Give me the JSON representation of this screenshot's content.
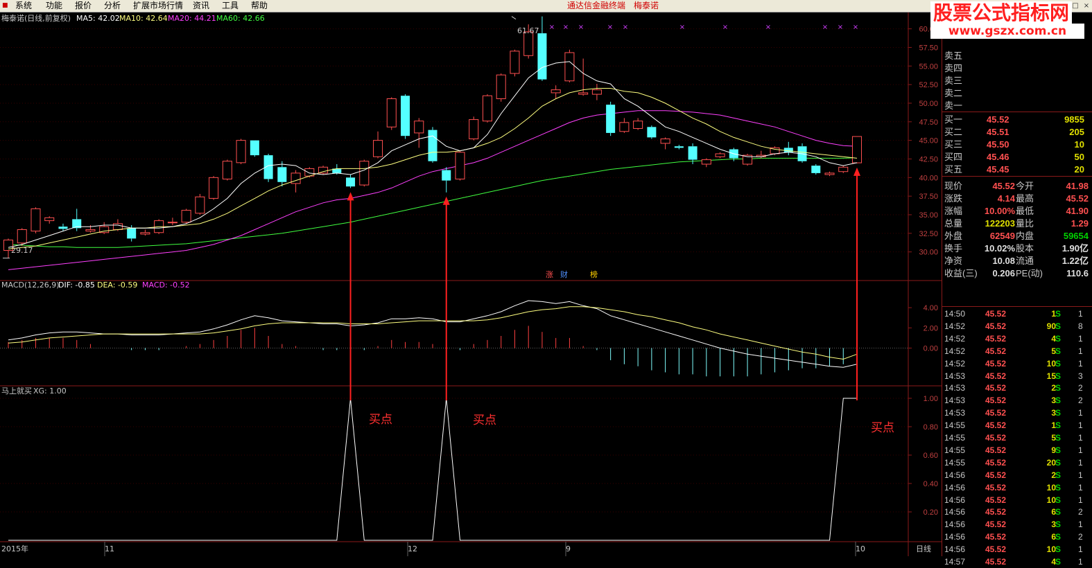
{
  "menu": {
    "items": [
      "系统",
      "功能",
      "报价",
      "分析",
      "扩展市场行情",
      "资讯",
      "工具",
      "帮助"
    ],
    "app_title": "通达信金融终端",
    "stock_title": "梅泰诺"
  },
  "watermark": {
    "line1": "股票公式指标网",
    "line2": "www.gszx.com.cn"
  },
  "main_header": {
    "name": "梅泰诺(日线,前复权)",
    "ma5": "MA5: 42.02",
    "ma10": "MA10: 42.64",
    "ma20": "MA20: 44.21",
    "ma60": "MA60: 42.66",
    "high_label": "61.67",
    "low_label": "29.17"
  },
  "macd_header": {
    "name": "MACD(12,26,9)",
    "dif": "DIF: -0.85",
    "dea": "DEA: -0.59",
    "macd": "MACD: -0.52"
  },
  "xg_header": {
    "name": "马上就买",
    "xg": "XG: 1.00"
  },
  "badges": [
    "涨",
    "财",
    "榜"
  ],
  "buy_labels": [
    "买点",
    "买点",
    "买点"
  ],
  "axis": {
    "price_ticks": [
      "60.00",
      "57.50",
      "55.00",
      "52.50",
      "50.00",
      "47.50",
      "45.00",
      "42.50",
      "40.00",
      "37.50",
      "35.00",
      "32.50",
      "30.00"
    ],
    "macd_ticks": [
      "4.00",
      "2.00",
      "0.00"
    ],
    "xg_ticks": [
      "1.00",
      "0.80",
      "0.60",
      "0.40",
      "0.20"
    ],
    "x_labels": [
      "2015年",
      "11",
      "12",
      "9",
      "10"
    ],
    "period": "日线"
  },
  "colors": {
    "up": "#ff5050",
    "down": "#54ffff",
    "ma5": "#ffffff",
    "ma10": "#ffff80",
    "ma20": "#ff40ff",
    "ma60": "#40ff40",
    "border": "#8b1a1a"
  },
  "order_book": {
    "sell": [
      {
        "label": "卖五",
        "price": "",
        "vol": ""
      },
      {
        "label": "卖四",
        "price": "",
        "vol": ""
      },
      {
        "label": "卖三",
        "price": "",
        "vol": ""
      },
      {
        "label": "卖二",
        "price": "",
        "vol": ""
      },
      {
        "label": "卖一",
        "price": "",
        "vol": ""
      }
    ],
    "buy": [
      {
        "label": "买一",
        "price": "45.52",
        "vol": "9855"
      },
      {
        "label": "买二",
        "price": "45.51",
        "vol": "205"
      },
      {
        "label": "买三",
        "price": "45.50",
        "vol": "10"
      },
      {
        "label": "买四",
        "price": "45.46",
        "vol": "50"
      },
      {
        "label": "买五",
        "price": "45.45",
        "vol": "20"
      }
    ]
  },
  "quote": [
    [
      {
        "label": "现价",
        "value": "45.52",
        "color": "#ff5050"
      },
      {
        "label": "今开",
        "value": "41.98",
        "color": "#ff5050"
      }
    ],
    [
      {
        "label": "涨跌",
        "value": "4.14",
        "color": "#ff5050"
      },
      {
        "label": "最高",
        "value": "45.52",
        "color": "#ff5050"
      }
    ],
    [
      {
        "label": "涨幅",
        "value": "10.00%",
        "color": "#ff5050"
      },
      {
        "label": "最低",
        "value": "41.90",
        "color": "#ff5050"
      }
    ],
    [
      {
        "label": "总量",
        "value": "122203",
        "color": "#e0e000"
      },
      {
        "label": "量比",
        "value": "1.29",
        "color": "#ff5050"
      }
    ],
    [
      {
        "label": "外盘",
        "value": "62549",
        "color": "#ff5050"
      },
      {
        "label": "内盘",
        "value": "59654",
        "color": "#00d000"
      }
    ],
    [
      {
        "label": "换手",
        "value": "10.02%",
        "color": "#e0e0e0"
      },
      {
        "label": "股本",
        "value": "1.90亿",
        "color": "#e0e0e0"
      }
    ],
    [
      {
        "label": "净资",
        "value": "10.08",
        "color": "#e0e0e0"
      },
      {
        "label": "流通",
        "value": "1.22亿",
        "color": "#e0e0e0"
      }
    ],
    [
      {
        "label": "收益(三)",
        "value": "0.206",
        "color": "#e0e0e0"
      },
      {
        "label": "PE(动)",
        "value": "110.6",
        "color": "#e0e0e0"
      }
    ]
  ],
  "ticks": [
    {
      "time": "14:50",
      "price": "45.52",
      "vol": "1",
      "side": "S",
      "num": "1"
    },
    {
      "time": "14:52",
      "price": "45.52",
      "vol": "90",
      "side": "S",
      "num": "8"
    },
    {
      "time": "14:52",
      "price": "45.52",
      "vol": "4",
      "side": "S",
      "num": "1"
    },
    {
      "time": "14:52",
      "price": "45.52",
      "vol": "5",
      "side": "S",
      "num": "1"
    },
    {
      "time": "14:52",
      "price": "45.52",
      "vol": "10",
      "side": "S",
      "num": "1"
    },
    {
      "time": "14:53",
      "price": "45.52",
      "vol": "15",
      "side": "S",
      "num": "3"
    },
    {
      "time": "14:53",
      "price": "45.52",
      "vol": "2",
      "side": "S",
      "num": "2"
    },
    {
      "time": "14:53",
      "price": "45.52",
      "vol": "3",
      "side": "S",
      "num": "2"
    },
    {
      "time": "14:53",
      "price": "45.52",
      "vol": "3",
      "side": "S",
      "num": "1"
    },
    {
      "time": "14:55",
      "price": "45.52",
      "vol": "1",
      "side": "S",
      "num": "1"
    },
    {
      "time": "14:55",
      "price": "45.52",
      "vol": "5",
      "side": "S",
      "num": "1"
    },
    {
      "time": "14:55",
      "price": "45.52",
      "vol": "9",
      "side": "S",
      "num": "1"
    },
    {
      "time": "14:55",
      "price": "45.52",
      "vol": "20",
      "side": "S",
      "num": "1"
    },
    {
      "time": "14:56",
      "price": "45.52",
      "vol": "2",
      "side": "S",
      "num": "1"
    },
    {
      "time": "14:56",
      "price": "45.52",
      "vol": "10",
      "side": "S",
      "num": "1"
    },
    {
      "time": "14:56",
      "price": "45.52",
      "vol": "10",
      "side": "S",
      "num": "1"
    },
    {
      "time": "14:56",
      "price": "45.52",
      "vol": "6",
      "side": "S",
      "num": "2"
    },
    {
      "time": "14:56",
      "price": "45.52",
      "vol": "3",
      "side": "S",
      "num": "1"
    },
    {
      "time": "14:56",
      "price": "45.52",
      "vol": "6",
      "side": "S",
      "num": "2"
    },
    {
      "time": "14:56",
      "price": "45.52",
      "vol": "10",
      "side": "S",
      "num": "1"
    },
    {
      "time": "14:57",
      "price": "45.52",
      "vol": "4",
      "side": "S",
      "num": "1"
    }
  ],
  "chart_data": {
    "type": "candlestick",
    "title": "梅泰诺(日线,前复权)",
    "ylim": [
      28.2,
      62.2
    ],
    "candles": [
      {
        "o": 30.2,
        "h": 31.8,
        "l": 29.17,
        "c": 31.6
      },
      {
        "o": 31.2,
        "h": 33.2,
        "l": 30.8,
        "c": 33.0
      },
      {
        "o": 32.8,
        "h": 36.0,
        "l": 32.5,
        "c": 35.8
      },
      {
        "o": 34.2,
        "h": 34.8,
        "l": 33.8,
        "c": 34.6
      },
      {
        "o": 33.4,
        "h": 33.8,
        "l": 32.8,
        "c": 33.1
      },
      {
        "o": 34.4,
        "h": 35.8,
        "l": 32.8,
        "c": 33.2
      },
      {
        "o": 32.8,
        "h": 33.6,
        "l": 32.6,
        "c": 33.0
      },
      {
        "o": 32.6,
        "h": 34.0,
        "l": 32.4,
        "c": 33.4
      },
      {
        "o": 33.0,
        "h": 34.4,
        "l": 32.8,
        "c": 33.8
      },
      {
        "o": 33.2,
        "h": 33.6,
        "l": 31.4,
        "c": 31.8
      },
      {
        "o": 32.4,
        "h": 33.0,
        "l": 32.2,
        "c": 32.6
      },
      {
        "o": 32.6,
        "h": 34.4,
        "l": 32.4,
        "c": 34.2
      },
      {
        "o": 34.0,
        "h": 34.6,
        "l": 33.6,
        "c": 34.0
      },
      {
        "o": 34.0,
        "h": 35.8,
        "l": 33.8,
        "c": 35.6
      },
      {
        "o": 35.2,
        "h": 37.8,
        "l": 35.0,
        "c": 37.4
      },
      {
        "o": 37.2,
        "h": 40.2,
        "l": 37.0,
        "c": 40.0
      },
      {
        "o": 39.8,
        "h": 42.4,
        "l": 39.6,
        "c": 42.2
      },
      {
        "o": 42.0,
        "h": 45.2,
        "l": 41.8,
        "c": 45.0
      },
      {
        "o": 45.0,
        "h": 45.0,
        "l": 42.8,
        "c": 43.0
      },
      {
        "o": 43.0,
        "h": 43.2,
        "l": 39.4,
        "c": 39.8
      },
      {
        "o": 41.4,
        "h": 42.2,
        "l": 38.8,
        "c": 39.4
      },
      {
        "o": 39.2,
        "h": 41.0,
        "l": 38.0,
        "c": 40.6
      },
      {
        "o": 40.2,
        "h": 41.4,
        "l": 40.0,
        "c": 41.2
      },
      {
        "o": 40.6,
        "h": 41.6,
        "l": 40.4,
        "c": 41.4
      },
      {
        "o": 41.2,
        "h": 41.8,
        "l": 40.4,
        "c": 40.6
      },
      {
        "o": 40.0,
        "h": 40.4,
        "l": 38.6,
        "c": 38.8
      },
      {
        "o": 39.0,
        "h": 42.4,
        "l": 38.8,
        "c": 42.2
      },
      {
        "o": 42.8,
        "h": 46.2,
        "l": 42.6,
        "c": 45.0
      },
      {
        "o": 46.8,
        "h": 50.8,
        "l": 46.4,
        "c": 50.6
      },
      {
        "o": 51.0,
        "h": 51.2,
        "l": 45.2,
        "c": 45.6
      },
      {
        "o": 46.0,
        "h": 48.0,
        "l": 44.0,
        "c": 47.6
      },
      {
        "o": 46.4,
        "h": 46.8,
        "l": 42.0,
        "c": 42.2
      },
      {
        "o": 41.0,
        "h": 41.4,
        "l": 38.0,
        "c": 39.6
      },
      {
        "o": 39.8,
        "h": 43.6,
        "l": 39.6,
        "c": 43.4
      },
      {
        "o": 45.2,
        "h": 48.2,
        "l": 45.0,
        "c": 47.8
      },
      {
        "o": 47.6,
        "h": 51.2,
        "l": 47.4,
        "c": 51.0
      },
      {
        "o": 50.6,
        "h": 54.0,
        "l": 50.2,
        "c": 53.8
      },
      {
        "o": 54.0,
        "h": 57.2,
        "l": 53.6,
        "c": 57.0
      },
      {
        "o": 56.4,
        "h": 60.6,
        "l": 56.0,
        "c": 59.6
      },
      {
        "o": 59.4,
        "h": 61.67,
        "l": 53.0,
        "c": 53.2
      },
      {
        "o": 51.4,
        "h": 52.4,
        "l": 50.6,
        "c": 51.8
      },
      {
        "o": 53.0,
        "h": 57.2,
        "l": 52.8,
        "c": 56.8
      },
      {
        "o": 51.2,
        "h": 56.0,
        "l": 51.0,
        "c": 51.4
      },
      {
        "o": 51.2,
        "h": 52.6,
        "l": 50.4,
        "c": 51.8
      },
      {
        "o": 49.8,
        "h": 50.2,
        "l": 45.6,
        "c": 46.0
      },
      {
        "o": 46.2,
        "h": 48.0,
        "l": 46.0,
        "c": 47.4
      },
      {
        "o": 46.6,
        "h": 48.0,
        "l": 46.4,
        "c": 47.6
      },
      {
        "o": 46.8,
        "h": 47.0,
        "l": 45.2,
        "c": 45.4
      },
      {
        "o": 44.6,
        "h": 45.4,
        "l": 43.8,
        "c": 45.2
      },
      {
        "o": 44.2,
        "h": 44.4,
        "l": 43.8,
        "c": 44.0
      },
      {
        "o": 44.2,
        "h": 44.6,
        "l": 41.8,
        "c": 42.4
      },
      {
        "o": 41.8,
        "h": 42.6,
        "l": 41.4,
        "c": 42.4
      },
      {
        "o": 42.8,
        "h": 43.4,
        "l": 42.6,
        "c": 43.2
      },
      {
        "o": 43.8,
        "h": 44.0,
        "l": 42.2,
        "c": 42.6
      },
      {
        "o": 41.8,
        "h": 43.2,
        "l": 41.6,
        "c": 43.0
      },
      {
        "o": 42.8,
        "h": 43.6,
        "l": 42.6,
        "c": 43.0
      },
      {
        "o": 43.2,
        "h": 44.2,
        "l": 43.0,
        "c": 44.0
      },
      {
        "o": 44.0,
        "h": 44.8,
        "l": 43.0,
        "c": 43.4
      },
      {
        "o": 44.2,
        "h": 44.6,
        "l": 42.0,
        "c": 42.2
      },
      {
        "o": 41.6,
        "h": 41.8,
        "l": 40.4,
        "c": 40.6
      },
      {
        "o": 40.4,
        "h": 40.8,
        "l": 40.2,
        "c": 40.6
      },
      {
        "o": 40.8,
        "h": 41.6,
        "l": 40.6,
        "c": 41.4
      },
      {
        "o": 41.98,
        "h": 45.52,
        "l": 41.9,
        "c": 45.52
      }
    ],
    "ma5": [
      30.6,
      31.0,
      31.6,
      32.2,
      32.8,
      33.4,
      33.4,
      33.6,
      33.6,
      33.2,
      33.2,
      33.2,
      33.4,
      33.8,
      34.6,
      35.8,
      37.2,
      39.2,
      40.6,
      41.6,
      41.8,
      41.6,
      40.6,
      40.4,
      40.6,
      40.4,
      41.0,
      42.0,
      43.6,
      44.4,
      45.2,
      45.6,
      44.2,
      43.6,
      44.0,
      45.8,
      48.6,
      51.0,
      53.4,
      54.8,
      55.4,
      55.6,
      54.0,
      53.0,
      52.6,
      50.6,
      49.6,
      48.2,
      46.8,
      46.2,
      45.4,
      44.6,
      43.8,
      43.2,
      42.8,
      42.8,
      43.2,
      43.4,
      43.2,
      42.8,
      42.0,
      41.6,
      42.0
    ],
    "ma10": [
      30.4,
      30.6,
      30.8,
      31.2,
      31.6,
      32.0,
      32.4,
      32.8,
      33.0,
      33.2,
      33.2,
      33.4,
      33.4,
      33.6,
      33.8,
      34.4,
      35.2,
      36.2,
      37.2,
      38.2,
      39.0,
      39.6,
      40.2,
      40.8,
      41.2,
      41.2,
      41.2,
      41.4,
      41.8,
      42.4,
      43.0,
      43.4,
      43.4,
      43.6,
      44.0,
      44.6,
      45.4,
      46.6,
      48.0,
      49.6,
      50.6,
      51.4,
      51.8,
      52.0,
      52.0,
      51.6,
      51.4,
      50.8,
      50.0,
      49.0,
      48.0,
      47.2,
      46.2,
      45.4,
      44.8,
      44.2,
      43.8,
      43.6,
      43.4,
      43.2,
      43.0,
      42.8,
      42.6
    ],
    "ma20": [
      27.6,
      27.8,
      28.0,
      28.2,
      28.4,
      28.6,
      28.8,
      29.0,
      29.2,
      29.4,
      29.6,
      29.8,
      30.0,
      30.2,
      30.6,
      31.0,
      31.6,
      32.2,
      33.0,
      33.8,
      34.6,
      35.4,
      36.0,
      36.6,
      37.0,
      37.2,
      37.6,
      38.0,
      38.6,
      39.4,
      40.2,
      40.8,
      41.2,
      41.6,
      42.0,
      42.6,
      43.4,
      44.2,
      45.0,
      45.8,
      46.6,
      47.4,
      48.0,
      48.4,
      48.6,
      48.8,
      49.0,
      49.0,
      49.0,
      48.9,
      48.8,
      48.6,
      48.4,
      48.0,
      47.6,
      47.2,
      46.8,
      46.2,
      45.6,
      45.0,
      44.6,
      44.3,
      44.2
    ],
    "ma60": [
      31.0,
      30.9,
      30.8,
      30.7,
      30.7,
      30.6,
      30.6,
      30.6,
      30.6,
      30.7,
      30.8,
      30.9,
      31.0,
      31.1,
      31.3,
      31.5,
      31.7,
      31.9,
      32.1,
      32.3,
      32.5,
      32.8,
      33.1,
      33.4,
      33.7,
      34.0,
      34.4,
      34.8,
      35.2,
      35.6,
      36.0,
      36.4,
      36.8,
      37.2,
      37.6,
      38.0,
      38.4,
      38.8,
      39.2,
      39.6,
      39.9,
      40.2,
      40.5,
      40.8,
      41.1,
      41.3,
      41.5,
      41.7,
      41.9,
      42.1,
      42.2,
      42.3,
      42.4,
      42.5,
      42.5,
      42.6,
      42.6,
      42.6,
      42.6,
      42.6,
      42.6,
      42.6,
      42.66
    ],
    "macd_ylim": [
      -3.6,
      6.0
    ],
    "dif": [
      0.8,
      1.0,
      1.3,
      1.5,
      1.6,
      1.6,
      1.5,
      1.4,
      1.4,
      1.3,
      1.3,
      1.3,
      1.4,
      1.5,
      1.6,
      1.9,
      2.3,
      2.8,
      3.2,
      3.0,
      2.7,
      2.6,
      2.5,
      2.4,
      2.4,
      2.2,
      2.3,
      2.5,
      2.9,
      2.9,
      3.0,
      2.9,
      2.6,
      2.6,
      2.9,
      3.2,
      3.6,
      4.2,
      4.7,
      4.6,
      4.4,
      4.6,
      4.2,
      3.9,
      3.2,
      2.8,
      2.4,
      2.0,
      1.6,
      1.2,
      0.8,
      0.4,
      0.0,
      -0.3,
      -0.6,
      -0.8,
      -1.0,
      -1.2,
      -1.4,
      -1.6,
      -1.8,
      -1.9,
      -1.6
    ],
    "dea": [
      0.5,
      0.6,
      0.8,
      1.0,
      1.1,
      1.2,
      1.3,
      1.4,
      1.4,
      1.4,
      1.4,
      1.4,
      1.4,
      1.4,
      1.4,
      1.5,
      1.7,
      1.9,
      2.2,
      2.4,
      2.5,
      2.5,
      2.5,
      2.5,
      2.5,
      2.4,
      2.4,
      2.4,
      2.5,
      2.6,
      2.7,
      2.7,
      2.7,
      2.7,
      2.7,
      2.8,
      3.0,
      3.3,
      3.6,
      3.8,
      3.9,
      4.1,
      4.1,
      4.0,
      3.8,
      3.6,
      3.3,
      3.1,
      2.8,
      2.5,
      2.1,
      1.8,
      1.4,
      1.1,
      0.8,
      0.5,
      0.2,
      -0.1,
      -0.4,
      -0.6,
      -0.9,
      -1.1,
      -0.6
    ],
    "macd": [
      0.6,
      0.8,
      1.0,
      1.0,
      1.0,
      0.8,
      0.4,
      0.0,
      0.0,
      -0.2,
      -0.2,
      -0.2,
      0.0,
      0.2,
      0.4,
      0.8,
      1.2,
      1.8,
      2.0,
      1.2,
      0.4,
      0.2,
      0.0,
      -0.2,
      -0.2,
      -0.4,
      -0.2,
      0.2,
      0.8,
      0.6,
      0.6,
      0.4,
      -0.2,
      -0.2,
      0.4,
      0.8,
      1.2,
      1.8,
      2.2,
      1.6,
      1.0,
      1.0,
      0.2,
      -0.2,
      -1.2,
      -1.6,
      -1.8,
      -2.2,
      -2.4,
      -2.6,
      -2.6,
      -2.8,
      -2.8,
      -2.8,
      -2.8,
      -2.6,
      -2.4,
      -2.2,
      -2.0,
      -2.0,
      -1.8,
      -1.6,
      -0.52
    ],
    "xg_ylim": [
      0.0,
      1.0
    ],
    "xg": [
      0,
      0,
      0,
      0,
      0,
      0,
      0,
      0,
      0,
      0,
      0,
      0,
      0,
      0,
      0,
      0,
      0,
      0,
      0,
      0,
      0,
      0,
      0,
      0,
      0,
      1,
      0,
      0,
      0,
      0,
      0,
      0,
      1,
      0,
      0,
      0,
      0,
      0,
      0,
      0,
      0,
      0,
      0,
      0,
      0,
      0,
      0,
      0,
      0,
      0,
      0,
      0,
      0,
      0,
      0,
      0,
      0,
      0,
      0,
      0,
      0,
      1,
      1
    ]
  }
}
